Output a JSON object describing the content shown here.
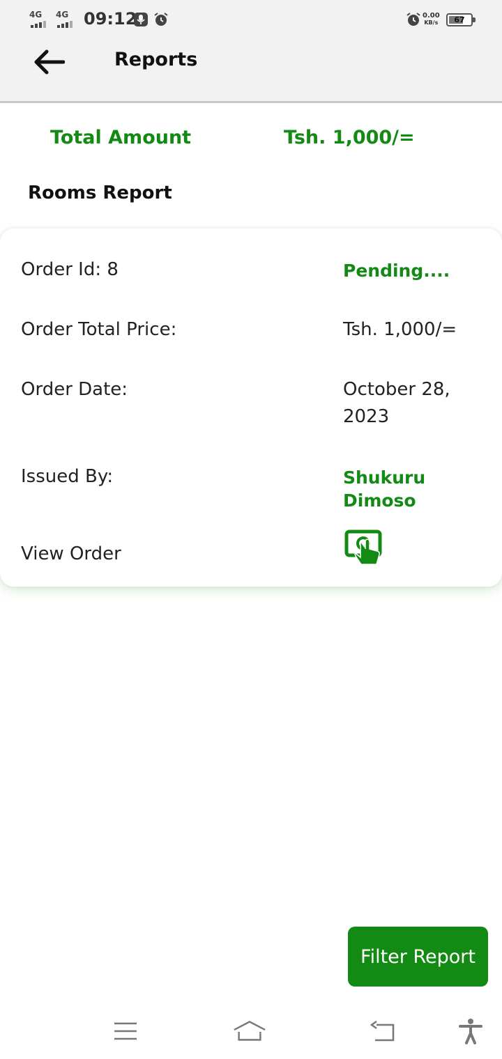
{
  "status_bar": {
    "sim1_tag": "4G",
    "sim2_tag": "4G",
    "time": "09:12",
    "net_speed_value": "0.00",
    "net_speed_unit": "KB/s",
    "battery_percent": "67",
    "battery_level": 0.67,
    "icons": [
      "signal-icon",
      "signal-icon",
      "mic-icon",
      "alarm-icon",
      "alarm-icon",
      "battery-icon"
    ]
  },
  "app_bar": {
    "title": "Reports",
    "back_icon": "arrow-left-icon"
  },
  "summary": {
    "total_label": "Total Amount",
    "total_value": "Tsh. 1,000/="
  },
  "section": {
    "title": "Rooms Report"
  },
  "order_card": {
    "order_id_label": "Order Id: 8",
    "status": "Pending....",
    "total_price_label": "Order Total Price:",
    "total_price_value": "Tsh. 1,000/=",
    "date_label": "Order Date:",
    "date_value": "October 28, 2023",
    "issued_by_label": "Issued By:",
    "issued_by_value": "Shukuru Dimoso",
    "view_label": "View Order",
    "view_icon": "tap-screen-icon"
  },
  "fab": {
    "label": "Filter Report"
  },
  "nav_bar": {
    "icons": [
      "menu-icon",
      "home-icon",
      "back-icon",
      "accessibility-icon"
    ]
  },
  "colors": {
    "accent_green": "#138a13",
    "header_bg": "#f2f2f2",
    "text": "#111111"
  }
}
